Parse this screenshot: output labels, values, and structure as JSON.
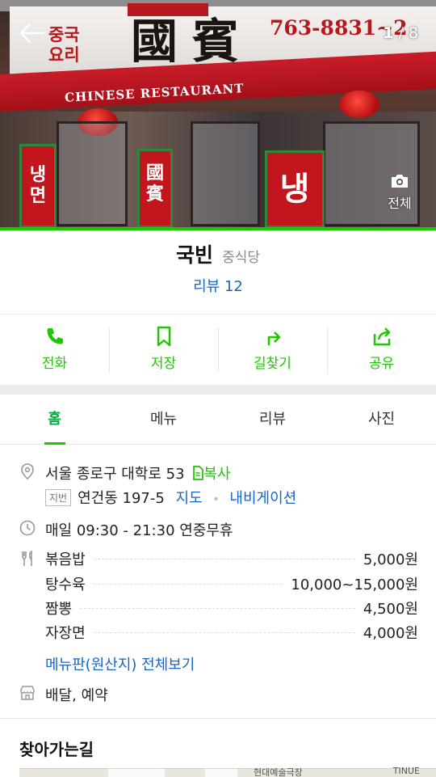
{
  "hero": {
    "counter_current": "1",
    "counter_total": "/ 8",
    "view_all_label": "전체",
    "sign_hanja": "國賓",
    "sign_korean_line1": "중국",
    "sign_korean_line2": "요리",
    "sign_phone": "763-8831~2",
    "awning_text": "CHINESE RESTAURANT",
    "banner_1": "냉면",
    "banner_2": "냉",
    "banner_3": "國賓"
  },
  "place": {
    "name": "국빈",
    "category": "중식당",
    "review_link": "리뷰 12"
  },
  "actions": [
    {
      "label": "전화",
      "icon": "phone-icon"
    },
    {
      "label": "저장",
      "icon": "bookmark-icon"
    },
    {
      "label": "길찾기",
      "icon": "directions-icon"
    },
    {
      "label": "공유",
      "icon": "share-icon"
    }
  ],
  "tabs": [
    {
      "label": "홈",
      "active": true
    },
    {
      "label": "메뉴",
      "active": false
    },
    {
      "label": "리뷰",
      "active": false
    },
    {
      "label": "사진",
      "active": false
    }
  ],
  "info": {
    "address": "서울 종로구 대학로 53",
    "copy_label": "복사",
    "jibun_badge": "지번",
    "jibun_address": "연건동 197-5",
    "map_link": "지도",
    "navigation_link": "내비게이션",
    "hours": "매일 09:30 - 21:30 연중무휴",
    "menu": [
      {
        "name": "볶음밥",
        "price": "5,000원"
      },
      {
        "name": "탕수육",
        "price": "10,000~15,000원"
      },
      {
        "name": "짬뽕",
        "price": "4,500원"
      },
      {
        "name": "자장면",
        "price": "4,000원"
      }
    ],
    "menu_full_link": "메뉴판(원산지) 전체보기",
    "services": "배달, 예약"
  },
  "directions": {
    "title": "찾아가는길",
    "map_label_1": "TINUE",
    "map_label_2": "현대예술극장"
  },
  "colors": {
    "accent_green": "#1ec800",
    "link_blue": "#1865c8",
    "tab_active": "#00a83f"
  }
}
